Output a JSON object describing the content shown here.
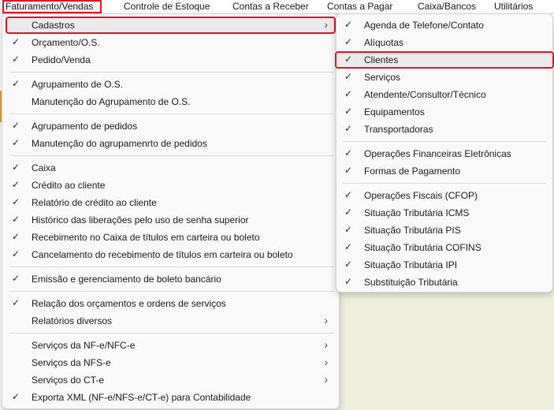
{
  "menubar": {
    "items": [
      {
        "label": "Faturamento/Vendas"
      },
      {
        "label": "Controle de Estoque"
      },
      {
        "label": "Contas a Receber"
      },
      {
        "label": "Contas a Pagar"
      },
      {
        "label": "Caixa/Bancos"
      },
      {
        "label": "Utilitários"
      }
    ]
  },
  "main_menu": {
    "items": [
      {
        "label": "Cadastros",
        "checked": false,
        "submenu": true
      },
      {
        "label": "Orçamento/O.S.",
        "checked": true
      },
      {
        "label": "Pedido/Venda",
        "checked": true
      },
      {
        "label": "Agrupamento de O.S.",
        "checked": true
      },
      {
        "label": "Manutenção do Agrupamento de O.S.",
        "checked": false
      },
      {
        "label": "Agrupamento de pedidos",
        "checked": true
      },
      {
        "label": "Manutenção do agrupamenrto de pedidos",
        "checked": true
      },
      {
        "label": "Caixa",
        "checked": true
      },
      {
        "label": "Crédito ao cliente",
        "checked": true
      },
      {
        "label": "Relatório de crédito ao cliente",
        "checked": true
      },
      {
        "label": "Histórico das liberações pelo uso de senha superior",
        "checked": true
      },
      {
        "label": "Recebimento no Caixa de títulos em carteira ou boleto",
        "checked": true
      },
      {
        "label": "Cancelamento do recebimento de títulos em carteira ou boleto",
        "checked": true
      },
      {
        "label": "Emissão e gerenciamento de boleto bancário",
        "checked": true
      },
      {
        "label": "Relação dos orçamentos e ordens de serviços",
        "checked": true
      },
      {
        "label": "Relatórios diversos",
        "checked": false,
        "submenu": true
      },
      {
        "label": "Serviços da NF-e/NFC-e",
        "checked": false,
        "submenu": true
      },
      {
        "label": "Serviços da NFS-e",
        "checked": false,
        "submenu": true
      },
      {
        "label": "Serviços do CT-e",
        "checked": false,
        "submenu": true
      },
      {
        "label": "Exporta XML (NF-e/NFS-e/CT-e) para Contabilidade",
        "checked": true
      }
    ]
  },
  "sub_menu": {
    "items": [
      {
        "label": "Agenda de Telefone/Contato",
        "checked": true
      },
      {
        "label": "Alíquotas",
        "checked": true
      },
      {
        "label": "Clientes",
        "checked": true
      },
      {
        "label": "Serviços",
        "checked": true
      },
      {
        "label": "Atendente/Consultor/Técnico",
        "checked": true
      },
      {
        "label": "Equipamentos",
        "checked": true
      },
      {
        "label": "Transportadoras",
        "checked": true
      },
      {
        "label": "Operações Financeiras Eletrônicas",
        "checked": true
      },
      {
        "label": "Formas de Pagamento",
        "checked": true
      },
      {
        "label": "Operações Fiscais (CFOP)",
        "checked": true
      },
      {
        "label": "Situação Tributária ICMS",
        "checked": true
      },
      {
        "label": "Situação Tributária PIS",
        "checked": true
      },
      {
        "label": "Situação Tributária COFINS",
        "checked": true
      },
      {
        "label": "Situação Tributária IPI",
        "checked": true
      },
      {
        "label": "Substituição Tributária",
        "checked": true
      }
    ]
  },
  "glyphs": {
    "check": "✓",
    "submenu_arrow": "›"
  },
  "colors": {
    "highlight_outline": "#e0141e",
    "menu_bg": "#f9f9f9",
    "hover_bg": "#ebebeb"
  }
}
